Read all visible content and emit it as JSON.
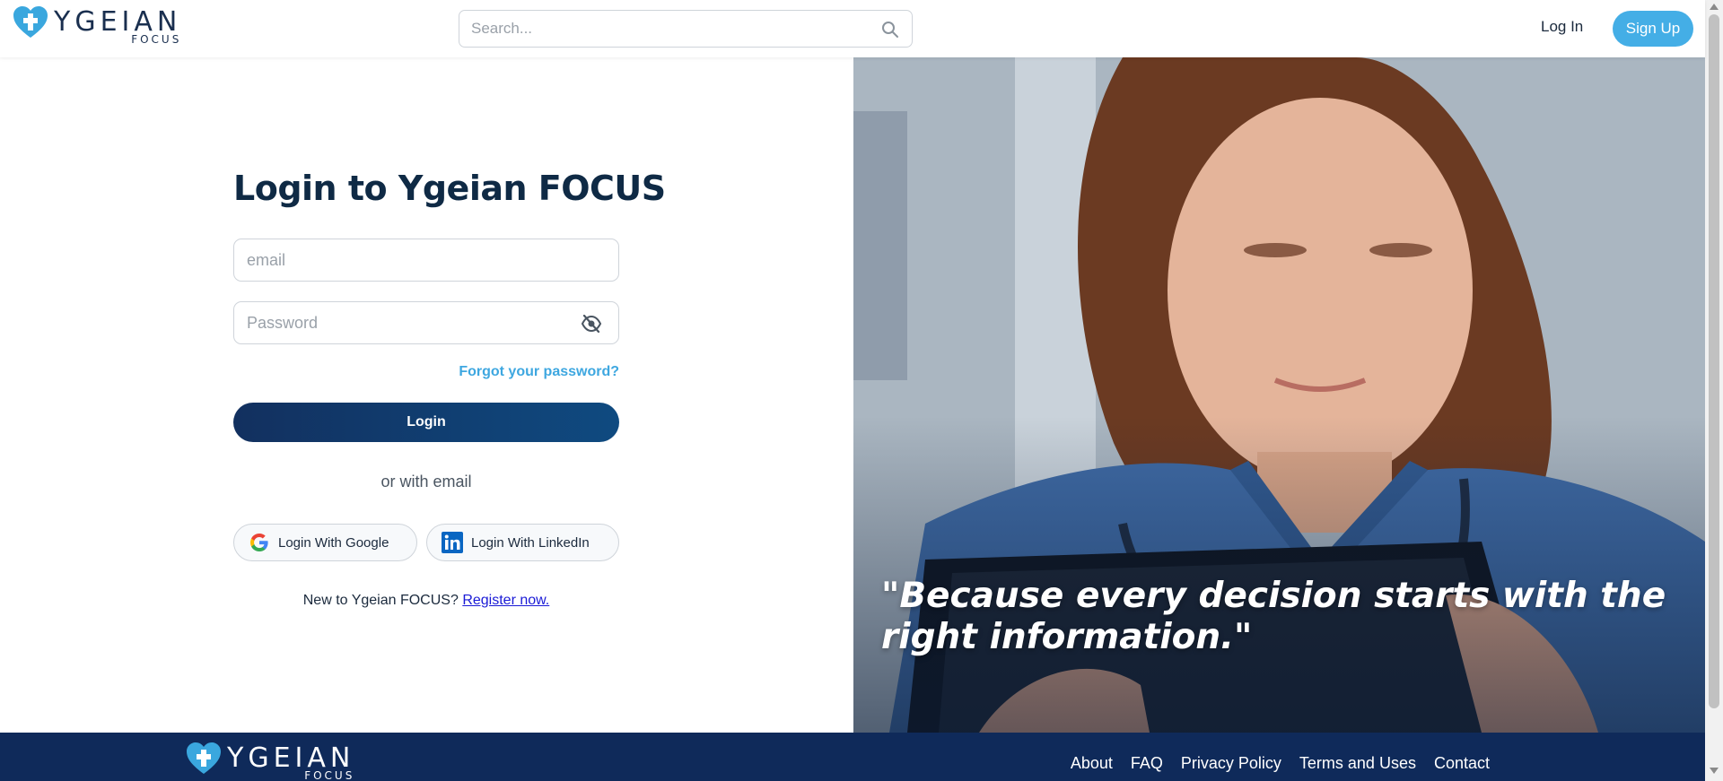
{
  "header": {
    "logo_word": "YGEIAN",
    "logo_sub": "FOCUS",
    "search_placeholder": "Search...",
    "login_label": "Log In",
    "signup_label": "Sign Up"
  },
  "form": {
    "title": "Login to Ygeian FOCUS",
    "email_placeholder": "email",
    "password_placeholder": "Password",
    "forgot_label": "Forgot your password?",
    "login_button": "Login",
    "or_text": "or with email",
    "google_label": "Login With Google",
    "linkedin_label": "Login With LinkedIn",
    "register_prompt": "New to Ygeian FOCUS?",
    "register_link": "Register now."
  },
  "hero": {
    "quote": "\"Because every decision starts with the right information.\""
  },
  "footer": {
    "logo_word": "YGEIAN",
    "logo_sub": "FOCUS",
    "links": [
      "About",
      "FAQ",
      "Privacy Policy",
      "Terms and Uses",
      "Contact"
    ]
  },
  "colors": {
    "accent": "#44aee6",
    "navy": "#0f2a5a",
    "title": "#0f2a45",
    "link": "#3ea7e0"
  },
  "icons": {
    "logo": "heart-cross-icon",
    "search": "search-icon",
    "password_toggle": "eye-off-icon",
    "google": "google-icon",
    "linkedin": "linkedin-icon"
  }
}
